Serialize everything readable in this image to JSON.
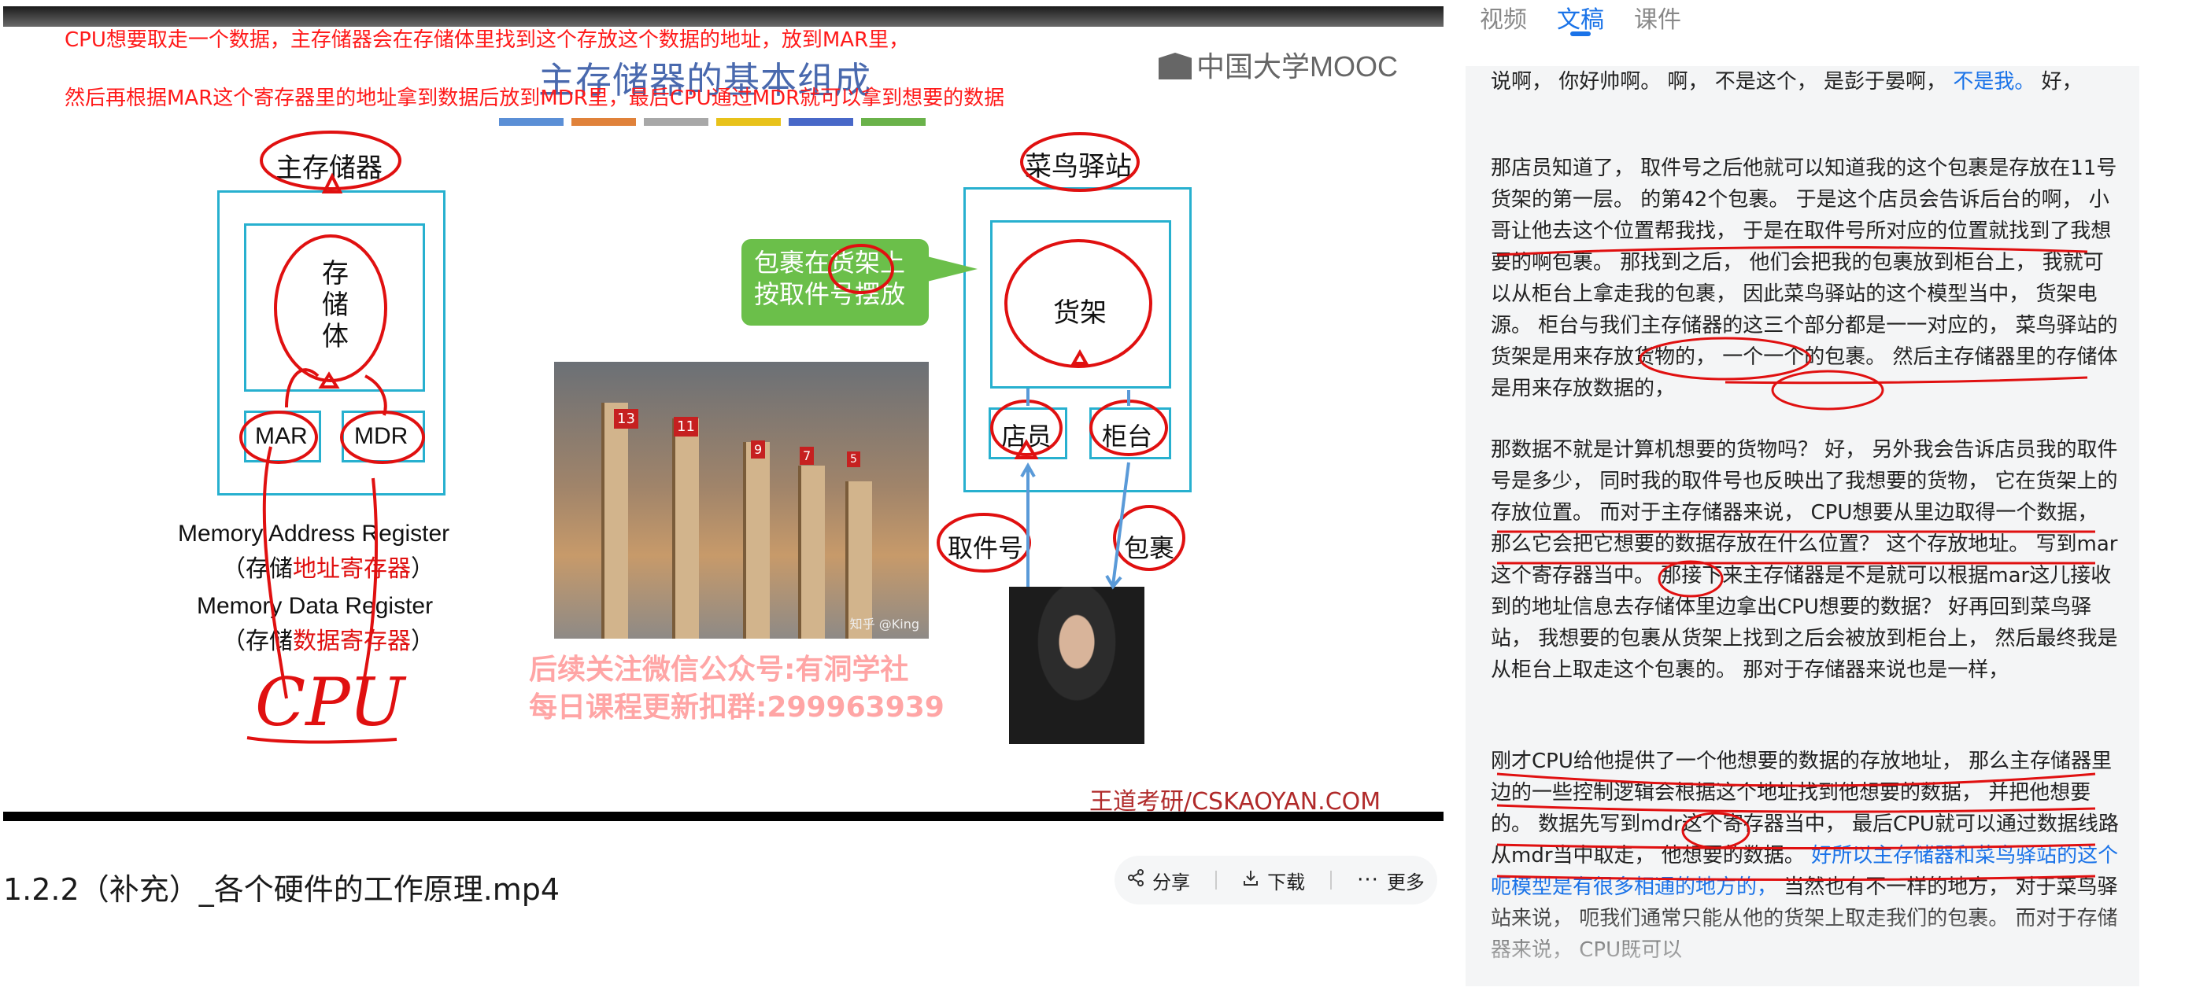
{
  "video": {
    "annotation_line1": "CPU想要取走一个数据，主存储器会在存储体里找到这个存放这个数据的地址，放到MAR里，",
    "annotation_line2": "然后再根据MAR这个寄存器里的地址拿到数据后放到MDR里，最后CPU通过MDR就可以拿到想要的数据",
    "slide_title": "主存储器的基本组成",
    "logo": "中国大学MOOC",
    "left_diagram": {
      "top_label": "主存储器",
      "storage_chars": [
        "存",
        "储",
        "体"
      ],
      "mar": "MAR",
      "mdr": "MDR",
      "mar_en": "Memory Address Register",
      "mar_cn_prefix": "（存储",
      "mar_cn_red": "地址寄存器",
      "mar_cn_suffix": "）",
      "mdr_en": "Memory Data Register",
      "mdr_cn_prefix": "（存储",
      "mdr_cn_red": "数据寄存器",
      "mdr_cn_suffix": "）",
      "cpu_handwritten": "CPU"
    },
    "right_diagram": {
      "top_label": "菜鸟驿站",
      "shelf": "货架",
      "clerk": "店员",
      "counter": "柜台",
      "pickup_no": "取件号",
      "package": "包裹",
      "bubble_line1": "包裹在货架上",
      "bubble_line2": "按取件号摆放"
    },
    "watermark_line1": "后续关注微信公众号:有洞学社",
    "watermark_line2": "每日课程更新扣群:299963939",
    "footer": "王道考研/CSKAOYAN.COM",
    "photo_credit": "知乎 @King",
    "shelf_numbers": [
      "13",
      "11",
      "9",
      "7",
      "5"
    ]
  },
  "video_title": "1.2.2（补充）_各个硬件的工作原理.mp4",
  "actions": {
    "share": "分享",
    "download": "下载",
    "more": "更多"
  },
  "tabs": [
    "视频",
    "文稿",
    "课件"
  ],
  "active_tab": "文稿",
  "transcript": {
    "p0_text": "说啊， 你好帅啊。 啊， 不是这个， 是彭于晏啊， ",
    "p0_blue": "不是我。",
    "p0_end": " 好，",
    "p1": "那店员知道了， 取件号之后他就可以知道我的这个包裹是存放在11号货架的第一层。 的第42个包裹。 于是这个店员会告诉后台的啊， 小哥让他去这个位置帮我找， 于是在取件号所对应的位置就找到了我想要的啊包裹。 那找到之后， 他们会把我的包裹放到柜台上， 我就可以从柜台上拿走我的包裹， 因此菜鸟驿站的这个模型当中， 货架电源。 柜台与我们主存储器的这三个部分都是一一对应的， 菜鸟驿站的货架是用来存放货物的， 一个一个的包裹。 然后主存储器里的存储体是用来存放数据的，",
    "p2": "那数据不就是计算机想要的货物吗？ 好， 另外我会告诉店员我的取件号是多少， 同时我的取件号也反映出了我想要的货物， 它在货架上的存放位置。 而对于主存储器来说， CPU想要从里边取得一个数据， 那么它会把它想要的数据存放在什么位置？ 这个存放地址。 写到mar这个寄存器当中。 那接下来主存储器是不是就可以根据mar这儿接收到的地址信息去存储体里边拿出CPU想要的数据？ 好再回到菜鸟驿站， 我想要的包裹从货架上找到之后会被放到柜台上， 然后最终我是从柜台上取走这个包裹的。 那对于存储器来说也是一样，",
    "p3_text": "刚才CPU给他提供了一个他想要的数据的存放地址， 那么主存储器里边的一些控制逻辑会根据这个地址找到他想要的数据， 并把他想要的。 数据先写到mdr这个寄存器当中， 最后CPU就可以通过数据线路从mdr当中取走， 他想要的数据。 ",
    "p3_blue": "好所以主存储器和菜鸟驿站的这个呃模型是有很多相通的地方的，",
    "p3_end": " 当然也有不一样的地方， 对于菜鸟驿站来说， 呃我们通常只能从他的货架上取走我们的包裹。 而对于存储器来说， CPU既可以"
  },
  "colors": {
    "accent": "#1a73e8",
    "annotation_red": "#ff1a1a",
    "diagram_cyan": "#27b0cf",
    "bubble_green": "#6bbf4a",
    "panel_bg": "#f4f5f6"
  }
}
